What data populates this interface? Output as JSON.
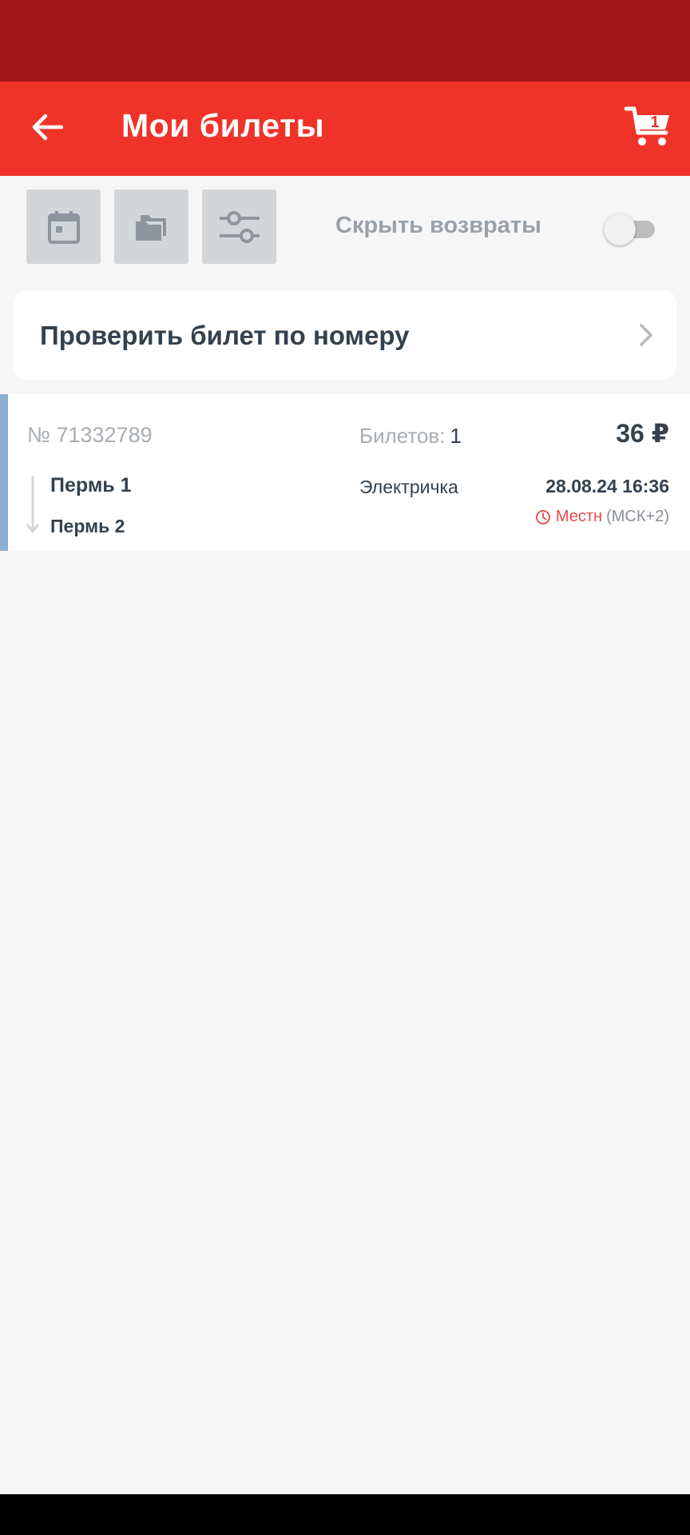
{
  "header": {
    "title": "Мои билеты",
    "cart_count": "1"
  },
  "toolbar": {
    "hide_returns_label": "Скрыть возвраты",
    "hide_returns_enabled": false
  },
  "check_ticket": {
    "label": "Проверить билет по номеру"
  },
  "tickets": [
    {
      "number": "№ 71332789",
      "count_label": "Билетов:",
      "count": "1",
      "price": "36 ₽",
      "from": "Пермь 1",
      "to": "Пермь 2",
      "train_type": "Электричка",
      "datetime": "28.08.24 16:36",
      "tz_local": "Местн",
      "tz_offset": "(МСК+2)"
    }
  ],
  "colors": {
    "statusbar": "#a2161b",
    "appbar": "#ef3328",
    "text_dark": "#34414e",
    "text_muted": "#a7adb3",
    "ticket_accent": "#8cb0d1",
    "local_time": "#e5474a"
  },
  "icons": {
    "back": "arrow-left-icon",
    "cart": "cart-icon",
    "calendar": "calendar-icon",
    "folder": "folder-icon",
    "filter": "sliders-icon",
    "chevron": "chevron-right-icon",
    "clock": "clock-icon"
  }
}
